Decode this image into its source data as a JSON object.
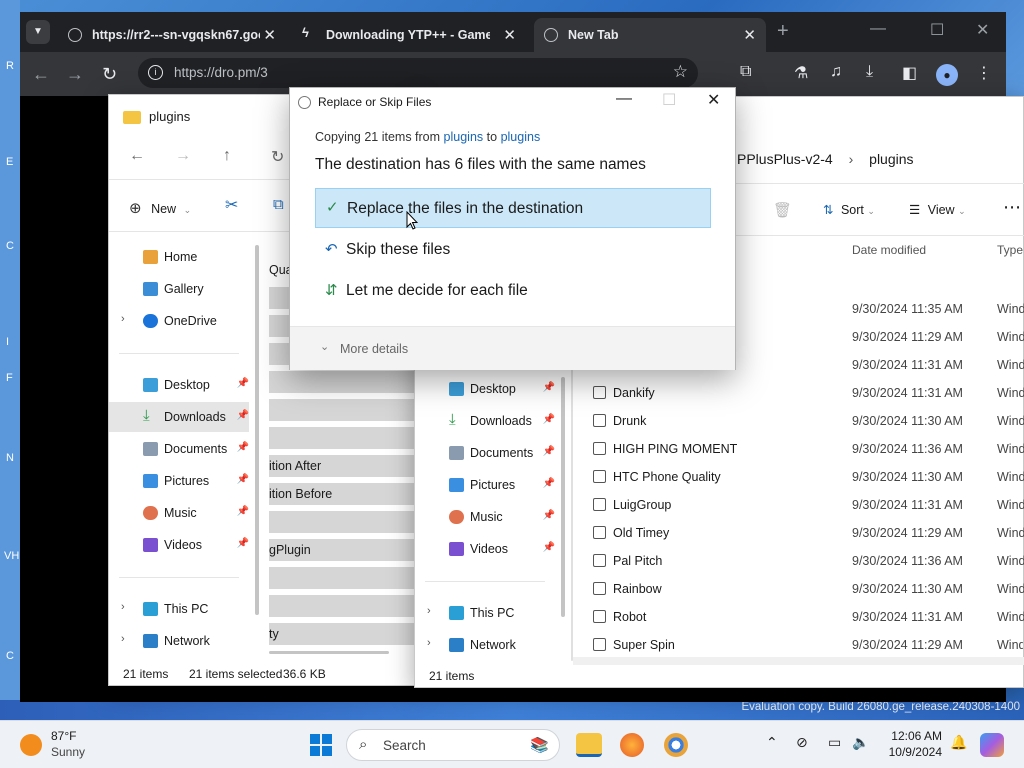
{
  "browser": {
    "tabs": [
      {
        "label": "https://rr2---sn-vgqskn67.goo",
        "active": false
      },
      {
        "label": "Downloading YTP++ - Game J",
        "active": false
      },
      {
        "label": "New Tab",
        "active": true
      }
    ],
    "url": "https://dro.pm/3"
  },
  "explorer_left": {
    "title": "plugins",
    "cmd_new": "New",
    "nav": [
      {
        "label": "Home",
        "icon": "home-icon"
      },
      {
        "label": "Gallery",
        "icon": "gallery-icon"
      },
      {
        "label": "OneDrive",
        "icon": "cloud-icon"
      },
      {
        "label": "Desktop",
        "icon": "desktop-icon"
      },
      {
        "label": "Downloads",
        "icon": "download-icon"
      },
      {
        "label": "Documents",
        "icon": "document-icon"
      },
      {
        "label": "Pictures",
        "icon": "picture-icon"
      },
      {
        "label": "Music",
        "icon": "music-icon"
      },
      {
        "label": "Videos",
        "icon": "video-icon"
      },
      {
        "label": "This PC",
        "icon": "pc-icon"
      },
      {
        "label": "Network",
        "icon": "network-icon"
      }
    ],
    "partial_rows": [
      "Qua",
      "ition After",
      "ition Before",
      "gPlugin",
      "ty"
    ],
    "status_count": "21 items",
    "status_selected": "21 items selected",
    "status_size": "36.6 KB"
  },
  "explorer_right": {
    "breadcrumb_1": "PPlusPlus-v2-4",
    "breadcrumb_2": "plugins",
    "sort_label": "Sort",
    "view_label": "View",
    "col_date": "Date modified",
    "col_type": "Type",
    "nav": [
      {
        "label": "Desktop"
      },
      {
        "label": "Downloads"
      },
      {
        "label": "Documents"
      },
      {
        "label": "Pictures"
      },
      {
        "label": "Music"
      },
      {
        "label": "Videos"
      },
      {
        "label": "This PC"
      },
      {
        "label": "Network"
      }
    ],
    "top_dates": [
      "9/30/2024 11:35 AM",
      "9/30/2024 11:29 AM",
      "9/30/2024 11:31 AM"
    ],
    "files": [
      {
        "name": "Dankify",
        "date": "9/30/2024 11:31 AM",
        "type": "Wind"
      },
      {
        "name": "Drunk",
        "date": "9/30/2024 11:30 AM",
        "type": "Wind"
      },
      {
        "name": "HIGH PING MOMENT",
        "date": "9/30/2024 11:36 AM",
        "type": "Wind"
      },
      {
        "name": "HTC Phone Quality",
        "date": "9/30/2024 11:30 AM",
        "type": "Wind"
      },
      {
        "name": "LuigGroup",
        "date": "9/30/2024 11:31 AM",
        "type": "Wind"
      },
      {
        "name": "Old Timey",
        "date": "9/30/2024 11:29 AM",
        "type": "Wind"
      },
      {
        "name": "Pal Pitch",
        "date": "9/30/2024 11:36 AM",
        "type": "Wind"
      },
      {
        "name": "Rainbow",
        "date": "9/30/2024 11:30 AM",
        "type": "Wind"
      },
      {
        "name": "Robot",
        "date": "9/30/2024 11:31 AM",
        "type": "Wind"
      },
      {
        "name": "Super Spin",
        "date": "9/30/2024 11:29 AM",
        "type": "Wind"
      }
    ],
    "top_type": "Wind",
    "status_count": "21 items"
  },
  "dialog": {
    "title": "Replace or Skip Files",
    "copy_prefix": "Copying 21 items from",
    "copy_from": "plugins",
    "copy_mid": "to",
    "copy_to": "plugins",
    "heading": "The destination has 6 files with the same names",
    "opt_replace": "Replace the files in the destination",
    "opt_skip": "Skip these files",
    "opt_decide": "Let me decide for each file",
    "more_details": "More details"
  },
  "desktop": {
    "watermark": "Evaluation copy. Build 26080.ge_release.240308-1400",
    "letters": [
      "R",
      "E",
      "C",
      "I",
      "F",
      "N",
      "VH",
      "C"
    ]
  },
  "taskbar": {
    "temp": "87°F",
    "condition": "Sunny",
    "search": "Search",
    "time": "12:06 AM",
    "date": "10/9/2024"
  }
}
